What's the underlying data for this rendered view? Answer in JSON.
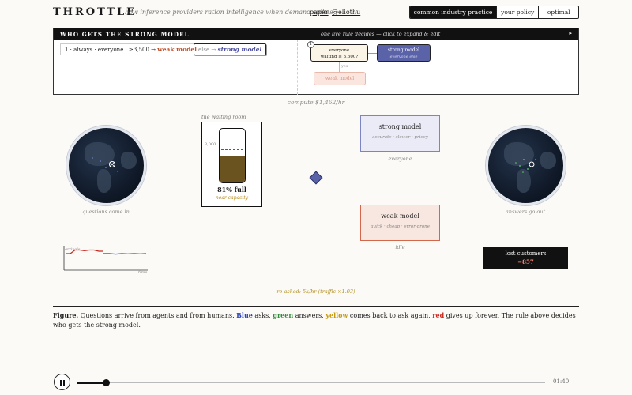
{
  "header": {
    "brand": "THROTTLE",
    "tagline": "how inference providers ration intelligence when demand spikes",
    "links": [
      "paper",
      "@eliothu"
    ],
    "tabs": [
      "common industry practice",
      "your policy",
      "optimal"
    ],
    "active_tab": 0
  },
  "rule_panel": {
    "title": "WHO GETS THE STRONG MODEL",
    "hint": "one live rule decides — click to expand & edit",
    "caret": "▸",
    "rule_prefix": "1 · always · everyone · ≥3,500 →",
    "rule_target": "weak model",
    "else_prefix": "else →",
    "else_target": "strong model",
    "badge": "1",
    "condition_line1": "everyone",
    "condition_line2": "waiting ≥ 3,500?",
    "yes_label": "yes",
    "strong_node_label": "strong model",
    "strong_node_sub": "everyone else",
    "weak_node_label": "weak model"
  },
  "compute_label": "compute $1,462/hr",
  "globes": {
    "in_caption": "questions come in",
    "out_caption": "answers go out"
  },
  "waiting_room": {
    "label": "the waiting room",
    "scale_label": "3,000",
    "fill_fraction": 0.81,
    "threshold_fraction": 0.61,
    "fill_text": "81% full",
    "status": "near capacity"
  },
  "models": {
    "strong": {
      "name": "strong model",
      "traits": "accurate · slower · pricey",
      "state": "everyone"
    },
    "weak": {
      "name": "weak model",
      "traits": "quick · cheap · error-prone",
      "state": "idle"
    }
  },
  "lost": {
    "label": "lost customers",
    "value": "−857"
  },
  "sparkline": {
    "label": "arrivals",
    "time_label": "time",
    "red_series": [
      0.3,
      0.3,
      0.15,
      0.15,
      0.18,
      0.15,
      0.15,
      0.2,
      0.2
    ],
    "blue_series": [
      0.3,
      0.3,
      0.32,
      0.3,
      0.31,
      0.3,
      0.31,
      0.3
    ]
  },
  "reasked": "re-asked: 5k/hr (traffic ×1.03)",
  "caption": {
    "lead": "Figure.",
    "t1": " Questions arrive from agents and from humans. ",
    "blue": "Blue",
    "t2": " asks, ",
    "green": "green",
    "t3": " answers, ",
    "yellow": "yellow",
    "t4": " comes back to ask again, ",
    "red": "red",
    "t5": " gives up forever. The rule above decides who gets the strong model."
  },
  "player": {
    "progress_fraction": 0.06,
    "time": "01:40",
    "icon": "pause-icon"
  },
  "colors": {
    "strong": "#5b63a8",
    "weak": "#d2674b",
    "tank_fill": "#6b531f",
    "threshold": "#c02a3a",
    "spark_red": "#c7281e",
    "spark_blue": "#2a43b8"
  }
}
